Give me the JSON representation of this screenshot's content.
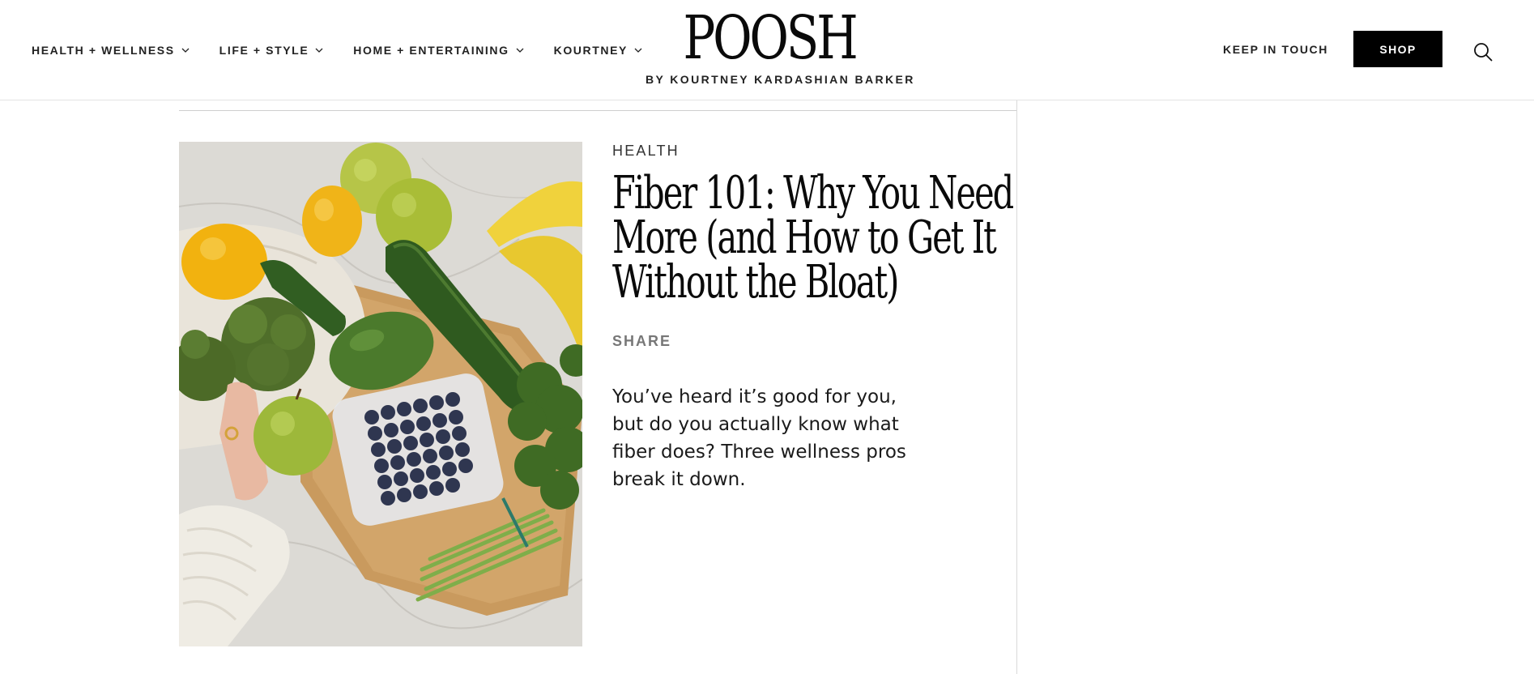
{
  "nav": {
    "items": [
      {
        "label": "HEALTH + WELLNESS"
      },
      {
        "label": "LIFE + STYLE"
      },
      {
        "label": "HOME + ENTERTAINING"
      },
      {
        "label": "KOURTNEY"
      }
    ]
  },
  "brand": {
    "logo": "POOSH",
    "tagline": "BY KOURTNEY KARDASHIAN BARKER"
  },
  "header_actions": {
    "keep_in_touch": "KEEP IN TOUCH",
    "shop": "SHOP",
    "search_icon": "search-icon"
  },
  "article": {
    "category": "HEALTH",
    "title": "Fiber 101: Why You Need More (and How to Get It Without the Bloat)",
    "share": "SHARE",
    "dek": "You’ve heard it’s good for you, but do you actually know what fiber does? Three wellness pros break it down."
  },
  "colors": {
    "background": "#ffffff",
    "text": "#111111",
    "button_bg": "#000000",
    "button_text": "#ffffff",
    "muted": "#777777"
  }
}
